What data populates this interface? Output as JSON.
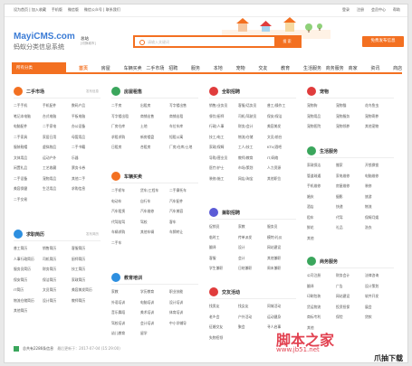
{
  "topbar": {
    "left": [
      "设为首页 | 加入收藏",
      "手机版",
      "微信版",
      "微信公众号 | 联系我们"
    ],
    "right": [
      "登录",
      "注册",
      "会员中心",
      "帮助"
    ]
  },
  "header": {
    "logo": "MayiCMS.com",
    "slogan": "蚂蚁分类信息系统",
    "city": "总站",
    "city_sub": "[切换城市]",
    "search_placeholder": "请输入关键词",
    "search_button": "搜 索",
    "post_button": "免费发布信息"
  },
  "nav": {
    "category": "所有分类",
    "items": [
      "首页",
      "房屋",
      "车辆买卖",
      "二手市场",
      "招聘",
      "服务",
      "本地",
      "宠物",
      "交友",
      "教育",
      "生活服务",
      "商务服务",
      "商家",
      "资讯",
      "商店",
      "店铺"
    ]
  },
  "sections": [
    {
      "id": "ershou",
      "title": "二手市场",
      "more": "发布信息",
      "color": "#f37021",
      "cols": 3,
      "items": [
        "二手手机",
        "手机配件",
        "数码产品",
        "笔记本电脑",
        "台式电脑",
        "平板电脑",
        "电脑配件",
        "二手家电",
        "办公设备",
        "二手家具",
        "家居日用",
        "母婴用品",
        "服装鞋帽",
        "虚拟物品",
        "二手书籍",
        "文体用品",
        "运动户外",
        "乐器",
        "闲置礼品",
        "工艺收藏",
        "票务卡券",
        "二手设备",
        "宠物用品",
        "其他二手",
        "美容保健",
        "生活用品",
        "求购信息",
        "二手交易"
      ]
    },
    {
      "id": "qiuzhi",
      "title": "求职简历",
      "more": "发布简历",
      "color": "#2d8fe0",
      "cols": 3,
      "items": [
        "普工简历",
        "销售简历",
        "客服简历",
        "人事行政简历",
        "司机简历",
        "厨师简历",
        "服务员简历",
        "财务简历",
        "技工简历",
        "保安简历",
        "保洁简历",
        "家政简历",
        "IT简历",
        "文员简历",
        "美容美发简历",
        "物流仓储简历",
        "设计简历",
        "教师简历",
        "其他简历"
      ]
    },
    {
      "id": "fangwu",
      "title": "房屋租售",
      "more": "",
      "color": "#3aa65c",
      "cols": 3,
      "items": [
        "二手房",
        "出租房",
        "写字楼出售",
        "写字楼出租",
        "商铺出售",
        "商铺出租",
        "厂房仓库",
        "土地",
        "车位车库",
        "求租求购",
        "新房楼盘",
        "短租公寓",
        "日租房",
        "合租房",
        "厂房/仓库/土地"
      ]
    },
    {
      "id": "cheliang",
      "title": "车辆买卖",
      "more": "",
      "color": "#f37021",
      "cols": 3,
      "items": [
        "二手轿车",
        "货车/工程车",
        "二手摩托车",
        "电动车",
        "自行车",
        "汽车配件",
        "汽车租赁",
        "汽车维修",
        "汽车美容",
        "代驾陪驾",
        "驾校",
        "客车",
        "车辆求购",
        "其他车辆",
        "车牌转让",
        "二手车"
      ]
    },
    {
      "id": "jiaoyu",
      "title": "教育培训",
      "more": "",
      "color": "#2d8fe0",
      "cols": 3,
      "items": [
        "家教",
        "学历教育",
        "职业技能",
        "外语培训",
        "电脑培训",
        "设计培训",
        "音乐舞蹈",
        "美术培训",
        "体育培训",
        "驾校培训",
        "会计培训",
        "中小学辅导",
        "幼儿教育",
        "留学"
      ]
    },
    {
      "id": "zhaopin",
      "title": "全职招聘",
      "more": "",
      "color": "#e03c3c",
      "cols": 3,
      "items": [
        "销售/业务员",
        "客服/话务员",
        "普工/操作工",
        "餐饮/厨师",
        "司机/驾驶员",
        "保安/保洁",
        "行政/人事",
        "财务/会计",
        "美容美发",
        "技工/电工",
        "物流/仓储",
        "文员/前台",
        "家政/保姆",
        "工人/技工",
        "KTV/酒吧",
        "导购/营业员",
        "教师/教育",
        "IT/网络",
        "医疗/护士",
        "市场/策划",
        "人力资源",
        "装修/施工",
        "网店/淘宝",
        "其他职位"
      ]
    },
    {
      "id": "jianzhi",
      "title": "兼职招聘",
      "more": "",
      "color": "#5b5bd6",
      "cols": 3,
      "items": [
        "促销员",
        "家教",
        "服务员",
        "临时工",
        "传单派发",
        "模特/礼仪",
        "翻译",
        "设计",
        "网站建设",
        "客服",
        "会计",
        "其他兼职",
        "学生兼职",
        "日结兼职",
        "周末兼职"
      ]
    },
    {
      "id": "jiaoyou",
      "title": "交友活动",
      "more": "",
      "color": "#e03c3c",
      "cols": 3,
      "items": [
        "找男友",
        "找女友",
        "同城活动",
        "老乡会",
        "户外活动",
        "运动健身",
        "征婚交友",
        "聚会",
        "寻人启事",
        "失物招领"
      ]
    },
    {
      "id": "chongwu",
      "title": "宠物",
      "more": "",
      "color": "#e03c3c",
      "cols": 3,
      "items": [
        "宠物狗",
        "宠物猫",
        "花鸟鱼虫",
        "宠物用品",
        "宠物服务",
        "宠物寄养",
        "宠物医院",
        "宠物领养",
        "其他宠物"
      ]
    },
    {
      "id": "shenghuo",
      "title": "生活服务",
      "more": "",
      "color": "#3aa65c",
      "cols": 3,
      "items": [
        "家政保洁",
        "搬家",
        "开锁换锁",
        "管道疏通",
        "家电维修",
        "电脑维修",
        "手机维修",
        "房屋维修",
        "装修",
        "婚庆",
        "摄影",
        "旅游",
        "酒店",
        "快递",
        "物流",
        "租车",
        "代驾",
        "保姆月嫂",
        "鲜花",
        "礼品",
        "洗衣",
        "其他"
      ]
    },
    {
      "id": "shangwu",
      "title": "商务服务",
      "more": "",
      "color": "#3aa65c",
      "cols": 3,
      "items": [
        "公司注册",
        "财务会计",
        "法律咨询",
        "翻译",
        "广告",
        "设计策划",
        "印刷包装",
        "网站建设",
        "软件开发",
        "货运物流",
        "投资担保",
        "展会",
        "商标专利",
        "保险",
        "贷款",
        "其他"
      ]
    }
  ],
  "footer": {
    "text": "总共有2286条信息",
    "sub": "最后更新于：2017-07-04 (15:29:00)"
  },
  "watermark": {
    "cn": "脚本之家",
    "url": "www.jb51.net",
    "corner": "爪抽下载网"
  },
  "colors": {
    "accent": "#f37021",
    "blue": "#2d8fe0",
    "green": "#3aa65c",
    "red": "#e03c3c"
  }
}
